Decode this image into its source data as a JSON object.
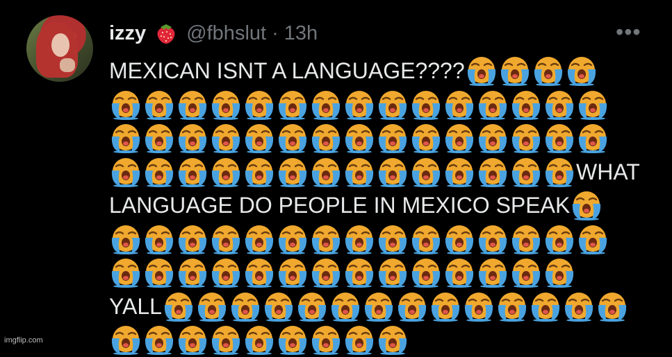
{
  "author": {
    "name": "izzy",
    "handle": "@fbhslut",
    "separator": "·",
    "time": "13h",
    "name_emoji_icon": "strawberry-icon",
    "avatar_desc": "profile-avatar"
  },
  "more_label": "•••",
  "tweet": {
    "emoji_icon": "loudly-crying-face-icon",
    "lines": [
      {
        "text_before": "MEXICAN ISNT A LANGUAGE????",
        "emoji_count": 4,
        "text_after": ""
      },
      {
        "text_before": "",
        "emoji_count": 15,
        "text_after": ""
      },
      {
        "text_before": "",
        "emoji_count": 15,
        "text_after": ""
      },
      {
        "text_before": "",
        "emoji_count": 14,
        "text_after": "WHAT"
      },
      {
        "text_before": "LANGUAGE DO PEOPLE IN MEXICO SPEAK",
        "emoji_count": 1,
        "text_after": ""
      },
      {
        "text_before": "",
        "emoji_count": 15,
        "text_after": ""
      },
      {
        "text_before": "",
        "emoji_count": 14,
        "text_after": ""
      },
      {
        "text_before": "YALL",
        "emoji_count": 14,
        "text_after": ""
      },
      {
        "text_before": "",
        "emoji_count": 9,
        "text_after": ""
      }
    ]
  },
  "watermark": "imgflip.com"
}
